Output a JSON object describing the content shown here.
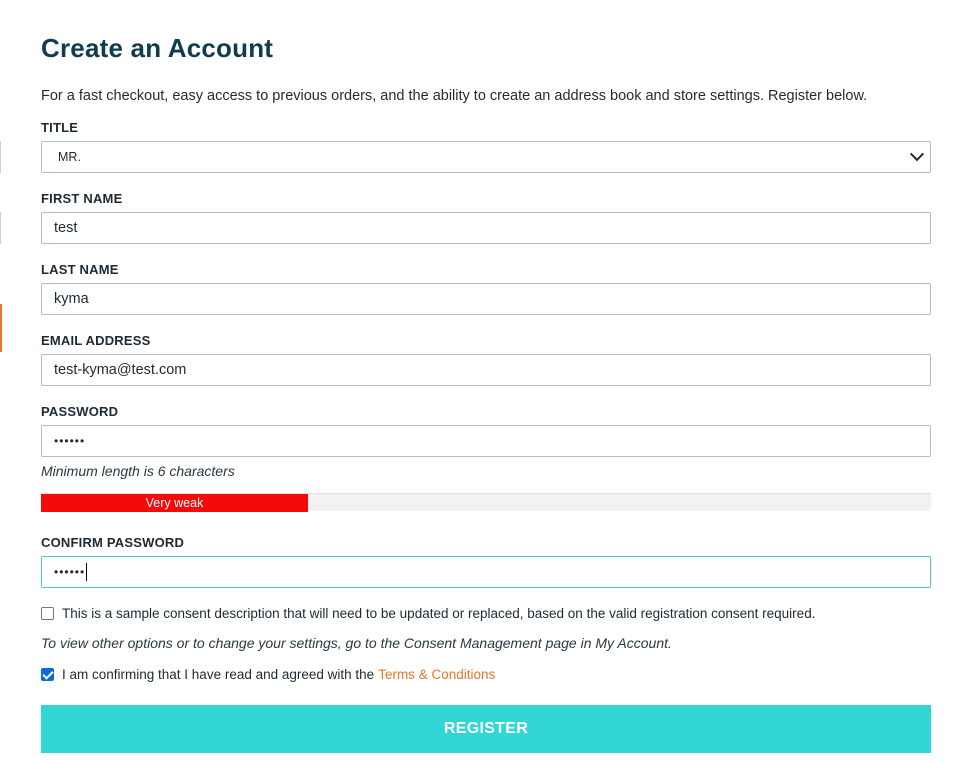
{
  "page": {
    "title": "Create an Account",
    "intro": "For a fast checkout, easy access to previous orders, and the ability to create an address book and store settings. Register below."
  },
  "form": {
    "title_label": "TITLE",
    "title_value": "MR.",
    "first_name_label": "FIRST NAME",
    "first_name_value": "test",
    "last_name_label": "LAST NAME",
    "last_name_value": "kyma",
    "email_label": "EMAIL ADDRESS",
    "email_value": "test-kyma@test.com",
    "password_label": "PASSWORD",
    "password_value": "••••••",
    "password_hint": "Minimum length is 6 characters",
    "strength_label": "Very weak",
    "strength_fraction": 0.3,
    "confirm_password_label": "CONFIRM PASSWORD",
    "confirm_password_value": "••••••",
    "consent_text": "This is a sample consent description that will need to be updated or replaced, based on the valid registration consent required.",
    "consent_checked": false,
    "settings_note": "To view other options or to change your settings, go to the Consent Management page in My Account.",
    "terms_text": "I am confirming that I have read and agreed with the",
    "terms_link": "Terms & Conditions",
    "terms_checked": true,
    "register_label": "REGISTER"
  },
  "colors": {
    "heading": "#0f3d4e",
    "accent_button": "#32d6d4",
    "link": "#e8752b",
    "strength_very_weak": "#f50a0a",
    "focus_border": "#4fc9c9"
  },
  "icons": {
    "select_chevron": "chevron-down-icon",
    "checkbox_checked": "checkmark-icon"
  }
}
